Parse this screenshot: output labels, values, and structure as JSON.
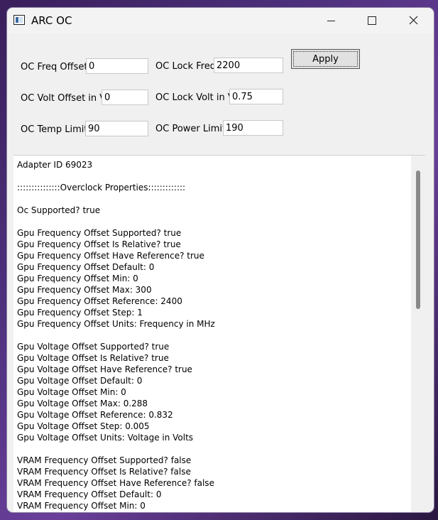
{
  "window": {
    "title": "ARC OC"
  },
  "form": {
    "freq_offset": {
      "label": "OC Freq Offset",
      "value": "0"
    },
    "lock_freq": {
      "label": "OC Lock Freq",
      "value": "2200"
    },
    "volt_offset": {
      "label": "OC Volt Offset in V",
      "value": "0"
    },
    "lock_volt": {
      "label": "OC Lock Volt in V",
      "value": "0.75"
    },
    "temp_limit": {
      "label": "OC Temp Limit",
      "value": "90"
    },
    "power_limit": {
      "label": "OC Power Limit",
      "value": "190"
    },
    "apply_label": "Apply"
  },
  "output": {
    "lines": [
      "Adapter ID 69023",
      "",
      ":::::::::::::::Overclock Properties:::::::::::::",
      "",
      "Oc Supported? true",
      "",
      "Gpu Frequency Offset Supported? true",
      "Gpu Frequency Offset Is Relative? true",
      "Gpu Frequency Offset Have Reference? true",
      "Gpu Frequency Offset Default: 0",
      "Gpu Frequency Offset Min: 0",
      "Gpu Frequency Offset Max: 300",
      "Gpu Frequency Offset Reference: 2400",
      "Gpu Frequency Offset Step: 1",
      "Gpu Frequency Offset Units: Frequency in MHz",
      "",
      "Gpu Voltage Offset Supported? true",
      "Gpu Voltage Offset Is Relative? true",
      "Gpu Voltage Offset Have Reference? true",
      "Gpu Voltage Offset Default: 0",
      "Gpu Voltage Offset Min: 0",
      "Gpu Voltage Offset Max: 0.288",
      "Gpu Voltage Offset Reference: 0.832",
      "Gpu Voltage Offset Step: 0.005",
      "Gpu Voltage Offset Units: Voltage in Volts",
      "",
      "VRAM Frequency Offset Supported? false",
      "VRAM Frequency Offset Is Relative? false",
      "VRAM Frequency Offset Have Reference? false",
      "VRAM Frequency Offset Default: 0",
      "VRAM Frequency Offset Min: 0"
    ]
  }
}
